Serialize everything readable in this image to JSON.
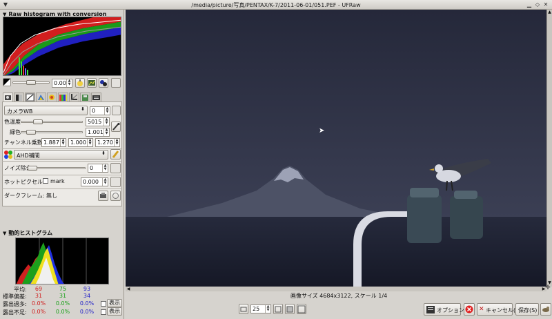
{
  "window": {
    "title": "/media/picture/写真/PENTAX/K-7/2011-06-01/051.PEF - UFRaw"
  },
  "raw_histogram": {
    "header": "Raw histogram with conversion curves"
  },
  "exposure": {
    "value": "0.00"
  },
  "wb": {
    "preset": "カメラWB",
    "fine_tune": "0",
    "temp_label": "色温度",
    "temp_value": "5015",
    "green_label": "緑色",
    "green_value": "1.001",
    "channel_label": "チャンネル乗数:",
    "mult_r": "1.887",
    "mult_g": "1.000",
    "mult_b": "1.270"
  },
  "interpolation": {
    "value": "AHD補間"
  },
  "denoise": {
    "label": "ノイズ除去",
    "value": "0"
  },
  "hotpixel": {
    "label": "ホットピクセル:0",
    "mark_label": "mark",
    "value": "0.000"
  },
  "darkframe": {
    "label": "ダークフレーム: 無し"
  },
  "live_histogram": {
    "header": "動的ヒストグラム",
    "avg_label": "平均:",
    "std_label": "標準偏差:",
    "over_label": "露出過多:",
    "under_label": "露出不足:",
    "avg": [
      "69",
      "75",
      "93"
    ],
    "std": [
      "31",
      "31",
      "34"
    ],
    "over": [
      "0.0%",
      "0.0%",
      "0.0%"
    ],
    "under": [
      "0.0%",
      "0.0%",
      "0.0%"
    ],
    "show_label": "表示"
  },
  "status": {
    "text": "画像サイズ 4684x3122, スケール 1/4"
  },
  "bottom": {
    "zoom": "25",
    "options_label": "オプション",
    "cancel_label": "キャンセル(C)",
    "save_label": "保存(S)"
  },
  "colors": {
    "sky": "#2c3043",
    "sea": "#1c2030",
    "mountain": "#6a6f85"
  }
}
